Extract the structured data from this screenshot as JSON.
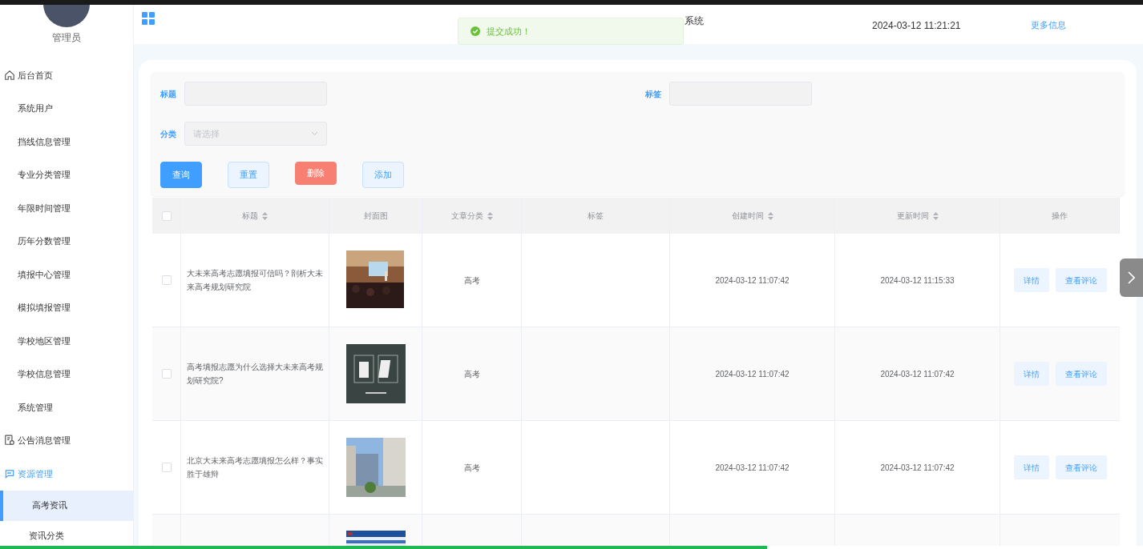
{
  "sidebar": {
    "user": "管理员",
    "items": [
      {
        "label": "后台首页",
        "kind": "group",
        "selected": false
      },
      {
        "label": "系统用户",
        "kind": "item",
        "selected": false
      },
      {
        "label": "挡线信息管理",
        "kind": "item",
        "selected": false
      },
      {
        "label": "专业分类管理",
        "kind": "item",
        "selected": false
      },
      {
        "label": "年限时间管理",
        "kind": "item",
        "selected": false
      },
      {
        "label": "历年分数管理",
        "kind": "item",
        "selected": false
      },
      {
        "label": "填报中心管理",
        "kind": "item",
        "selected": false
      },
      {
        "label": "模拟填报管理",
        "kind": "item",
        "selected": false
      },
      {
        "label": "学校地区管理",
        "kind": "item",
        "selected": false
      },
      {
        "label": "学校信息管理",
        "kind": "item",
        "selected": false
      },
      {
        "label": "系统管理",
        "kind": "item",
        "selected": false
      },
      {
        "label": "公告消息管理",
        "kind": "group",
        "selected": false
      },
      {
        "label": "资源管理",
        "kind": "group",
        "selected": true
      },
      {
        "label": "高考资讯",
        "kind": "subitem",
        "selected": true
      },
      {
        "label": "资讯分类",
        "kind": "subitem",
        "selected": false
      }
    ]
  },
  "header": {
    "title": "系统",
    "datetime": "2024-03-12 11:21:21",
    "link": "更多信息"
  },
  "toast": {
    "message": "提交成功！"
  },
  "search": {
    "fields": [
      {
        "label": "标题",
        "kind": "input"
      },
      {
        "label": "标签",
        "kind": "input"
      },
      {
        "label": "分类",
        "kind": "select",
        "placeholder": "请选择"
      }
    ],
    "buttons": [
      {
        "label": "查询",
        "kind": "primary"
      },
      {
        "label": "重置",
        "kind": "plain"
      },
      {
        "label": "删除",
        "kind": "danger"
      },
      {
        "label": "添加",
        "kind": "plain"
      }
    ]
  },
  "table": {
    "all_checked": false,
    "columns": [
      {
        "label": "标题",
        "sortable": true
      },
      {
        "label": "封面图",
        "sortable": false
      },
      {
        "label": "文章分类",
        "sortable": true
      },
      {
        "label": "标签",
        "sortable": false
      },
      {
        "label": "创建时间",
        "sortable": true
      },
      {
        "label": "更新时间",
        "sortable": true
      },
      {
        "label": "操作",
        "sortable": false
      }
    ],
    "rows": [
      {
        "kind": "full",
        "checked": false,
        "title": "大未来高考志愿填报可信吗？剖析大未来高考规划研究院",
        "category": "高考",
        "created": "2024-03-12 11:07:42",
        "updated": "2024-03-12 11:15:33",
        "actions": [
          "详情",
          "查看评论"
        ]
      },
      {
        "kind": "full",
        "checked": false,
        "title": "高考填报志愿为什么选择大未来高考规划研究院?",
        "category": "高考",
        "created": "2024-03-12 11:07:42",
        "updated": "2024-03-12 11:07:42",
        "actions": [
          "详情",
          "查看评论"
        ]
      },
      {
        "kind": "full",
        "checked": false,
        "title": "北京大未来高考志愿填报怎么样？事实胜于雄辩",
        "category": "高考",
        "created": "2024-03-12 11:07:42",
        "updated": "2024-03-12 11:07:42",
        "actions": [
          "详情",
          "查看评论"
        ]
      },
      {
        "kind": "partial"
      }
    ]
  },
  "player": {
    "level": 0.671
  }
}
